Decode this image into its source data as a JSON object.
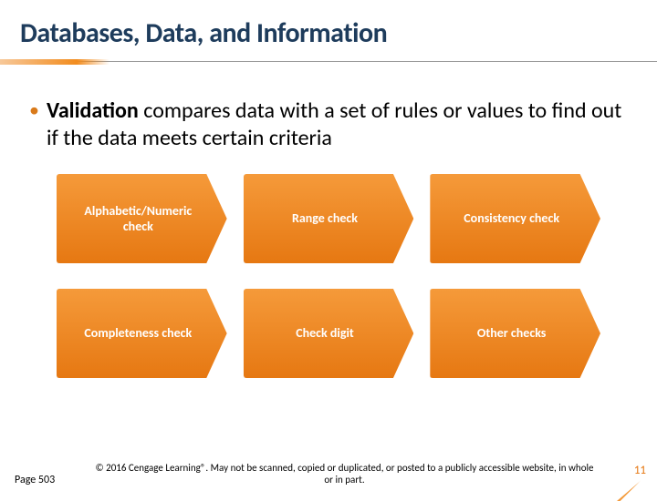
{
  "title": "Databases, Data, and Information",
  "bullet": {
    "bold": "Validation",
    "rest": " compares data with a set of rules or values to find out if the data meets certain criteria"
  },
  "cards": [
    "Alphabetic/Numeric check",
    "Range check",
    "Consistency check",
    "Completeness check",
    "Check digit",
    "Other checks"
  ],
  "footer": {
    "pageRef": "Page 503",
    "copyright": "© 2016 Cengage Learning®. May not be scanned, copied or duplicated, or posted to a publicly accessible website, in whole or in part.",
    "slideNumber": "11"
  }
}
